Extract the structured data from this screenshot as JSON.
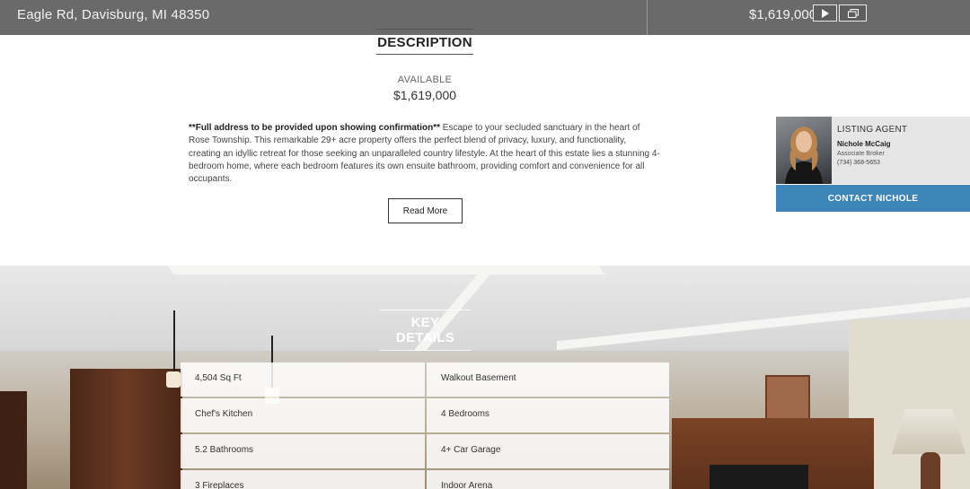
{
  "topbar": {
    "address": "Eagle Rd, Davisburg, MI 48350",
    "price": "$1,619,000"
  },
  "description": {
    "heading": "DESCRIPTION",
    "status_label": "AVAILABLE",
    "price": "$1,619,000",
    "body_bold": "**Full address to be provided upon showing confirmation**",
    "body_text": " Escape to your secluded sanctuary in the heart of Rose Township. This remarkable 29+ acre property offers the perfect blend of privacy, luxury, and functionality, creating an idyllic retreat for those seeking an unparalleled country lifestyle. At the heart of this estate lies a stunning 4-bedroom home, where each bedroom features its own ensuite bathroom, providing comfort and convenience for all occupants.",
    "read_more_label": "Read More"
  },
  "agent": {
    "title": "LISTING AGENT",
    "name": "Nichole McCaig",
    "role": "Associate Broker",
    "phone": "(734) 368-5653",
    "contact_label": "CONTACT NICHOLE"
  },
  "key_details": {
    "heading": "KEY DETAILS",
    "rows": [
      [
        "4,504 Sq Ft",
        "Walkout Basement"
      ],
      [
        "Chef's Kitchen",
        "4 Bedrooms"
      ],
      [
        "5.2 Bathrooms",
        "4+ Car Garage"
      ],
      [
        "3 Fireplaces",
        "Indoor Arena"
      ]
    ]
  },
  "colors": {
    "topbar_bg": "#6a6a6a",
    "contact_button": "#3d84b8"
  },
  "icons": {
    "play": "play-icon",
    "gallery": "gallery-icon"
  }
}
